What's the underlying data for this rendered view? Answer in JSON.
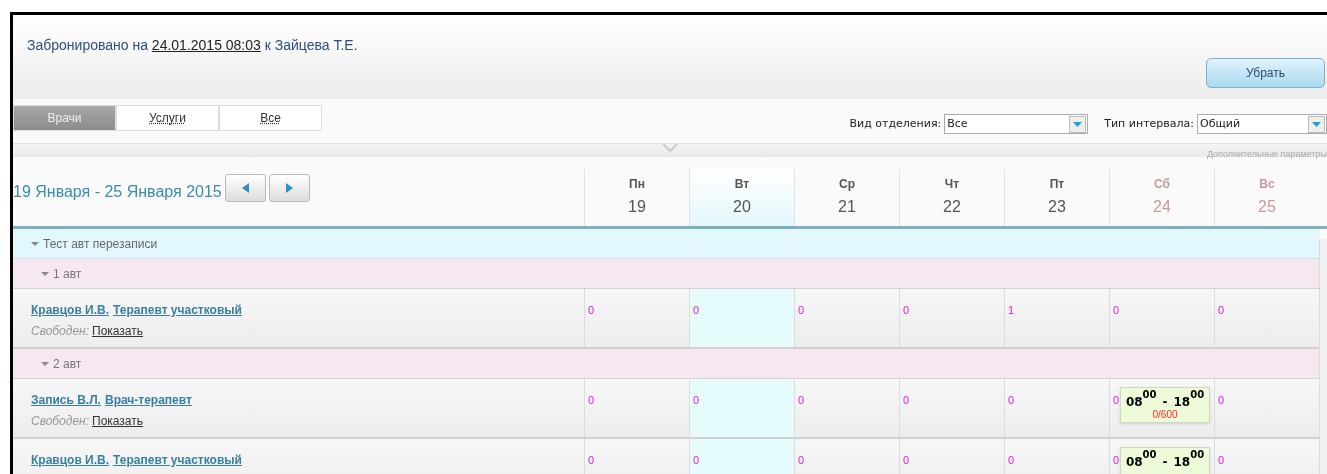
{
  "header": {
    "text_before": "Забронировано на",
    "date_link": "24.01.2015 08:03",
    "text_after": "к Зайцева Т.Е.",
    "button": "Убрать"
  },
  "tabs": [
    {
      "label": "Врачи",
      "selected": true
    },
    {
      "label": "Услуги",
      "selected": false
    },
    {
      "label": "Все",
      "selected": false
    }
  ],
  "filters": [
    {
      "label": "Вид отделения:",
      "value": "Все"
    },
    {
      "label": "Тип интервала:",
      "value": "Общий"
    }
  ],
  "more_params": "Дополнительные параметры",
  "week": {
    "range": "19 Января - 25 Января 2015"
  },
  "days": [
    {
      "name": "Пн",
      "date": "19",
      "weekend": false,
      "selected": false
    },
    {
      "name": "Вт",
      "date": "20",
      "weekend": false,
      "selected": true
    },
    {
      "name": "Ср",
      "date": "21",
      "weekend": false,
      "selected": false
    },
    {
      "name": "Чт",
      "date": "22",
      "weekend": false,
      "selected": false
    },
    {
      "name": "Пт",
      "date": "23",
      "weekend": false,
      "selected": false
    },
    {
      "name": "Сб",
      "date": "24",
      "weekend": true,
      "selected": false
    },
    {
      "name": "Вс",
      "date": "25",
      "weekend": true,
      "selected": false
    }
  ],
  "groups": [
    {
      "title": "Тест авт перезаписи",
      "expanded": true,
      "subgroups": [
        {
          "title": "1 авт",
          "expanded": true,
          "doctors": [
            {
              "name": "Кравцов И.В.",
              "specialty": "Терапевт участковый",
              "free_label": "Свободен:",
              "free_link": "Показать",
              "cells": [
                {
                  "count": "0"
                },
                {
                  "count": "0"
                },
                {
                  "count": "0"
                },
                {
                  "count": "0"
                },
                {
                  "count": "1"
                },
                {
                  "count": "0"
                },
                {
                  "count": "0"
                }
              ]
            }
          ]
        },
        {
          "title": "2 авт",
          "expanded": true,
          "doctors": [
            {
              "name": "Запись В.Л.",
              "specialty": "Врач-терапевт",
              "free_label": "Свободен:",
              "free_link": "Показать",
              "cells": [
                {
                  "count": "0"
                },
                {
                  "count": "0"
                },
                {
                  "count": "0"
                },
                {
                  "count": "0"
                },
                {
                  "count": "0"
                },
                {
                  "count": "0",
                  "slot": {
                    "start_h": "08",
                    "start_m": "00",
                    "sep": "-",
                    "end_h": "18",
                    "end_m": "00",
                    "quota": "0/600"
                  }
                },
                {
                  "count": "0"
                }
              ]
            },
            {
              "name": "Кравцов И.В.",
              "specialty": "Терапевт участковый",
              "cells": [
                {
                  "count": "0"
                },
                {
                  "count": "0"
                },
                {
                  "count": "0"
                },
                {
                  "count": "0"
                },
                {
                  "count": "0"
                },
                {
                  "count": "0",
                  "slot": {
                    "start_h": "08",
                    "start_m": "00",
                    "sep": "-",
                    "end_h": "18",
                    "end_m": "00"
                  }
                },
                {
                  "count": "0"
                }
              ]
            }
          ]
        }
      ]
    }
  ]
}
